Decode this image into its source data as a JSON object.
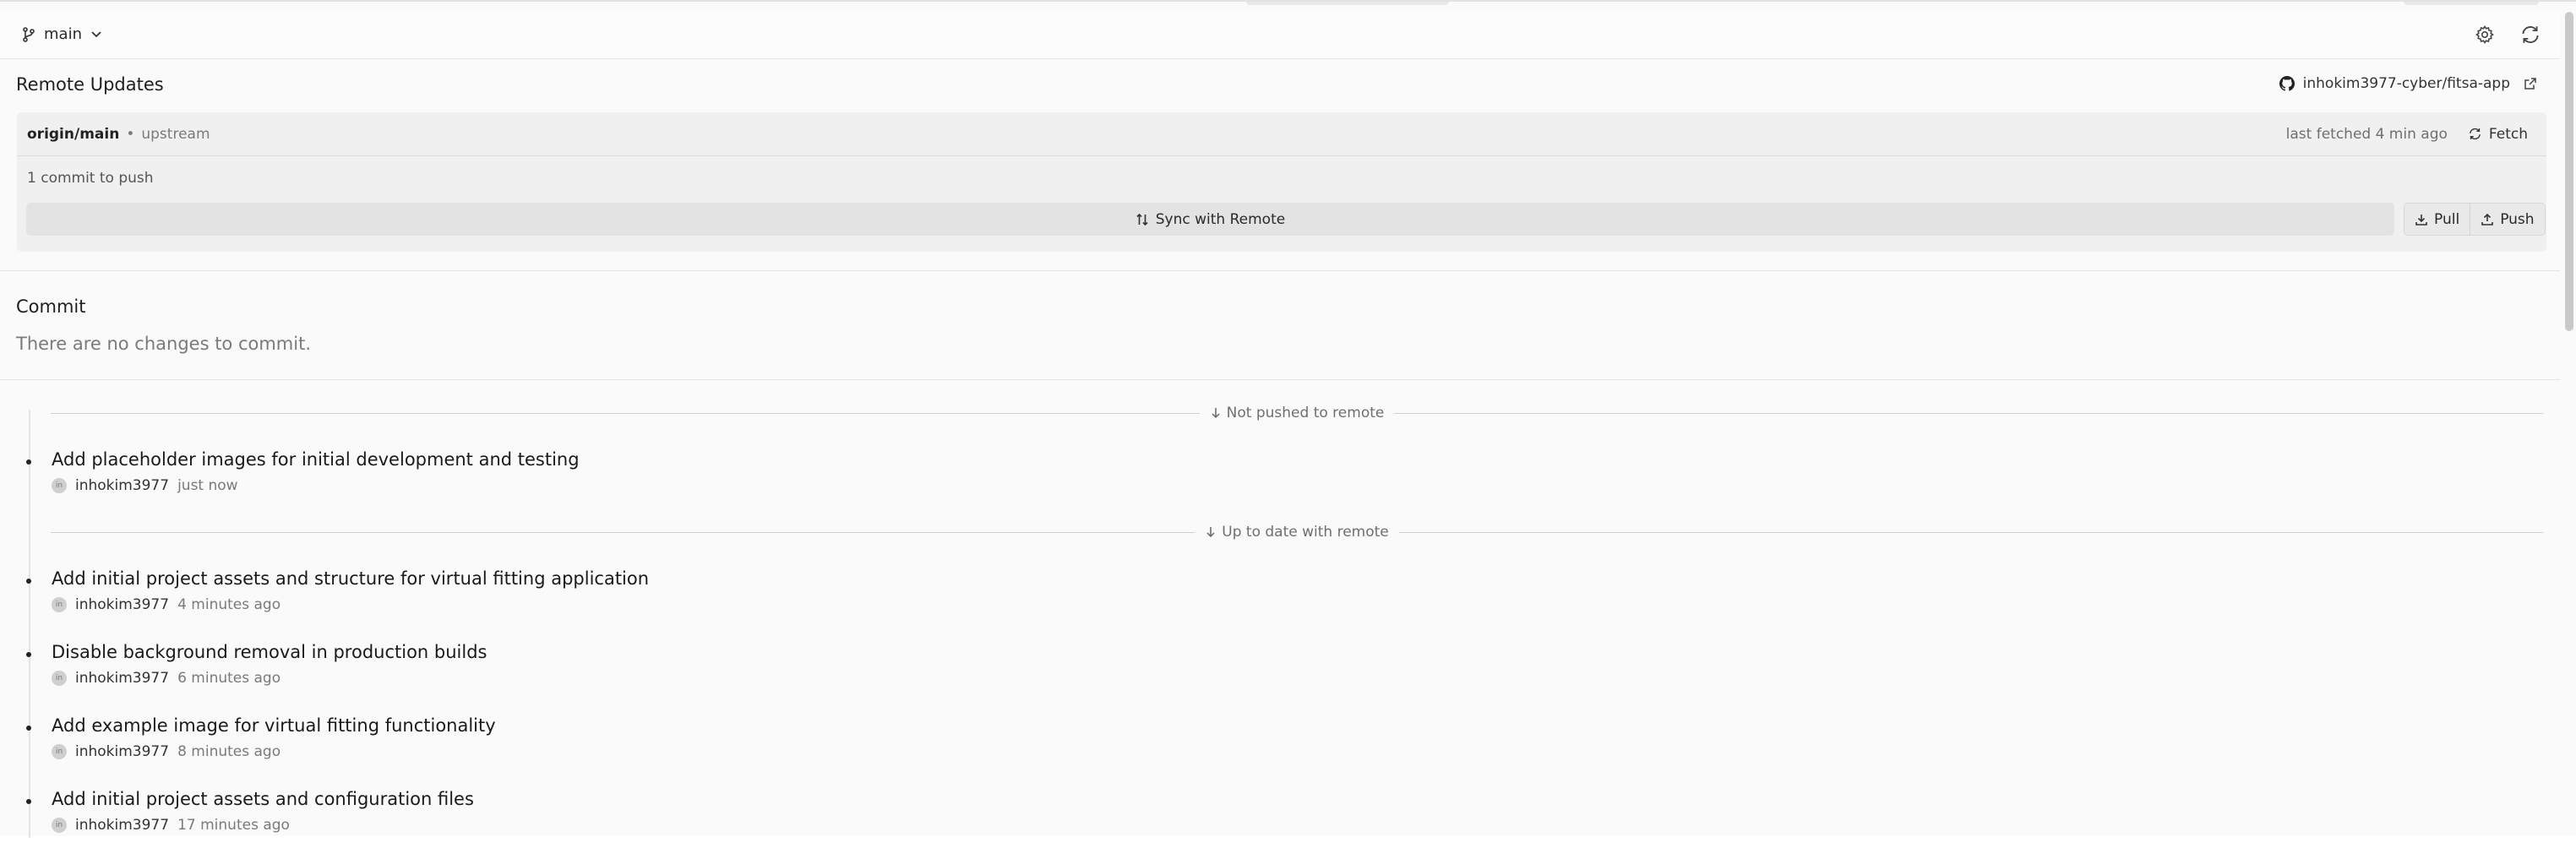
{
  "header": {
    "branch": "main"
  },
  "remote": {
    "title": "Remote Updates",
    "repo": "inhokim3977-cyber/fitsa-app",
    "remote_name": "origin/main",
    "separator": "•",
    "tracking": "upstream",
    "last_fetched": "last fetched 4 min ago",
    "fetch_label": "Fetch",
    "commits_to_push": "1 commit to push",
    "sync_label": "Sync with Remote",
    "pull_label": "Pull",
    "push_label": "Push"
  },
  "commit_panel": {
    "title": "Commit",
    "empty_message": "There are no changes to commit."
  },
  "history": {
    "not_pushed_label": "Not pushed to remote",
    "up_to_date_label": "Up to date with remote",
    "avatar_initial": "in",
    "unpushed": [
      {
        "message": "Add placeholder images for initial development and testing",
        "author": "inhokim3977",
        "time": "just now"
      }
    ],
    "pushed": [
      {
        "message": "Add initial project assets and structure for virtual fitting application",
        "author": "inhokim3977",
        "time": "4 minutes ago"
      },
      {
        "message": "Disable background removal in production builds",
        "author": "inhokim3977",
        "time": "6 minutes ago"
      },
      {
        "message": "Add example image for virtual fitting functionality",
        "author": "inhokim3977",
        "time": "8 minutes ago"
      },
      {
        "message": "Add initial project assets and configuration files",
        "author": "inhokim3977",
        "time": "17 minutes ago"
      }
    ]
  }
}
